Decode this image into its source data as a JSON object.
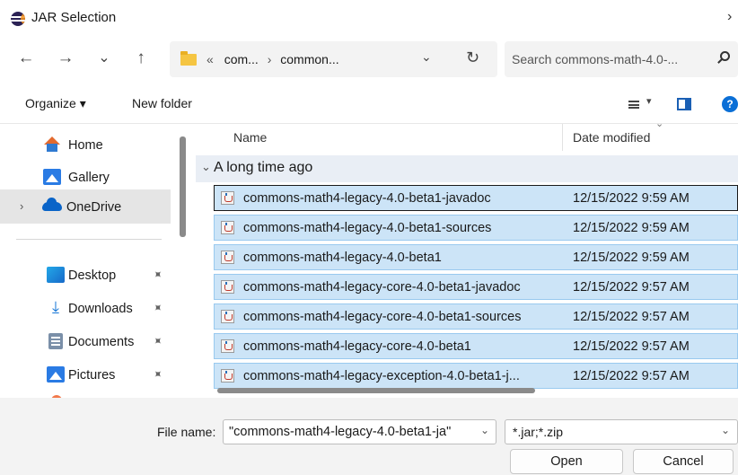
{
  "window": {
    "title": "JAR Selection",
    "close_glyph": "›"
  },
  "navigation": {
    "back_glyph": "←",
    "forward_glyph": "→",
    "history_glyph": "⌄",
    "up_glyph": "↑",
    "breadcrumb_overflow": "«",
    "breadcrumb": [
      "com...",
      "common..."
    ],
    "breadcrumb_separator": "›",
    "dropdown_glyph": "⌄",
    "refresh_glyph": "↻",
    "search_placeholder": "Search commons-math-4.0-..."
  },
  "toolbar": {
    "organize_label": "Organize ▾",
    "new_folder_label": "New folder",
    "view_dropdown_glyph": "▾",
    "help_glyph": "?"
  },
  "sidebar": {
    "items": [
      {
        "label": "Home",
        "icon": "home-icon"
      },
      {
        "label": "Gallery",
        "icon": "gallery-icon"
      },
      {
        "label": "OneDrive",
        "icon": "onedrive-icon",
        "selected": true,
        "expand_glyph": "›"
      }
    ],
    "quick_access": [
      {
        "label": "Desktop",
        "icon": "desktop-icon",
        "pin_glyph": "📌"
      },
      {
        "label": "Downloads",
        "icon": "downloads-icon",
        "pin_glyph": "📌"
      },
      {
        "label": "Documents",
        "icon": "documents-icon",
        "pin_glyph": "📌"
      },
      {
        "label": "Pictures",
        "icon": "pictures-icon",
        "pin_glyph": "📌"
      }
    ]
  },
  "file_list": {
    "columns": [
      "Name",
      "Date modified"
    ],
    "sort_glyph": "⌄",
    "group": {
      "label": "A long time ago",
      "collapse_glyph": "⌄"
    },
    "files": [
      {
        "name": "commons-math4-legacy-4.0-beta1-javadoc",
        "date": "12/15/2022 9:59 AM",
        "focused": true
      },
      {
        "name": "commons-math4-legacy-4.0-beta1-sources",
        "date": "12/15/2022 9:59 AM"
      },
      {
        "name": "commons-math4-legacy-4.0-beta1",
        "date": "12/15/2022 9:59 AM"
      },
      {
        "name": "commons-math4-legacy-core-4.0-beta1-javadoc",
        "date": "12/15/2022 9:57 AM"
      },
      {
        "name": "commons-math4-legacy-core-4.0-beta1-sources",
        "date": "12/15/2022 9:57 AM"
      },
      {
        "name": "commons-math4-legacy-core-4.0-beta1",
        "date": "12/15/2022 9:57 AM"
      },
      {
        "name": "commons-math4-legacy-exception-4.0-beta1-j...",
        "date": "12/15/2022 9:57 AM"
      }
    ]
  },
  "footer": {
    "file_name_label": "File name:",
    "file_name_value": "\"commons-math4-legacy-4.0-beta1-ja\"",
    "file_name_dropdown_glyph": "⌄",
    "file_type_value": "*.jar;*.zip",
    "file_type_dropdown_glyph": "⌄",
    "open_label": "Open",
    "cancel_label": "Cancel"
  },
  "colors": {
    "selection_fill": "#cce4f7",
    "selection_border": "#99c9ef",
    "accent": "#0b6fd6"
  }
}
